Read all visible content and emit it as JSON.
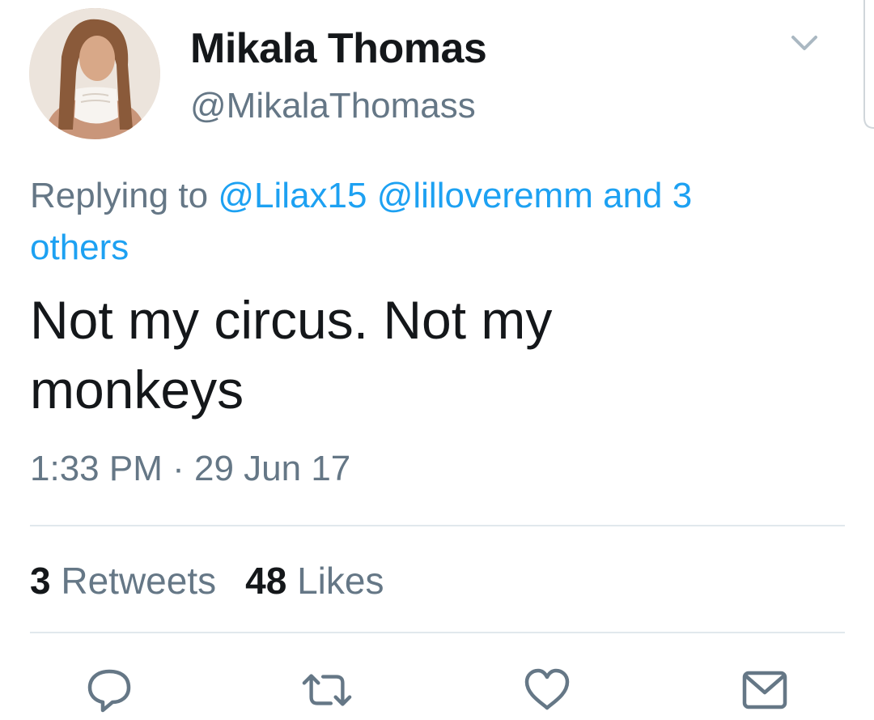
{
  "author": {
    "display_name": "Mikala Thomas",
    "handle": "@MikalaThomass"
  },
  "reply": {
    "prefix": "Replying to",
    "mention_1": "@Lilax15",
    "mention_2": "@lilloveremm",
    "and_others_a": "and 3",
    "and_others_b": "others"
  },
  "tweet": {
    "text_line1": "Not my circus. Not my",
    "text_line2": "monkeys"
  },
  "meta": {
    "time": "1:33 PM",
    "separator": "·",
    "date": "29 Jun 17"
  },
  "stats": {
    "retweets_count": "3",
    "retweets_label": "Retweets",
    "likes_count": "48",
    "likes_label": "Likes"
  },
  "actions": {
    "reply_icon": "reply-icon",
    "retweet_icon": "retweet-icon",
    "like_icon": "heart-icon",
    "dm_icon": "envelope-icon"
  },
  "colors": {
    "text": "#14171a",
    "secondary": "#657786",
    "link": "#1da1f2",
    "divider": "#e1e8ed",
    "icon": "#657786"
  }
}
